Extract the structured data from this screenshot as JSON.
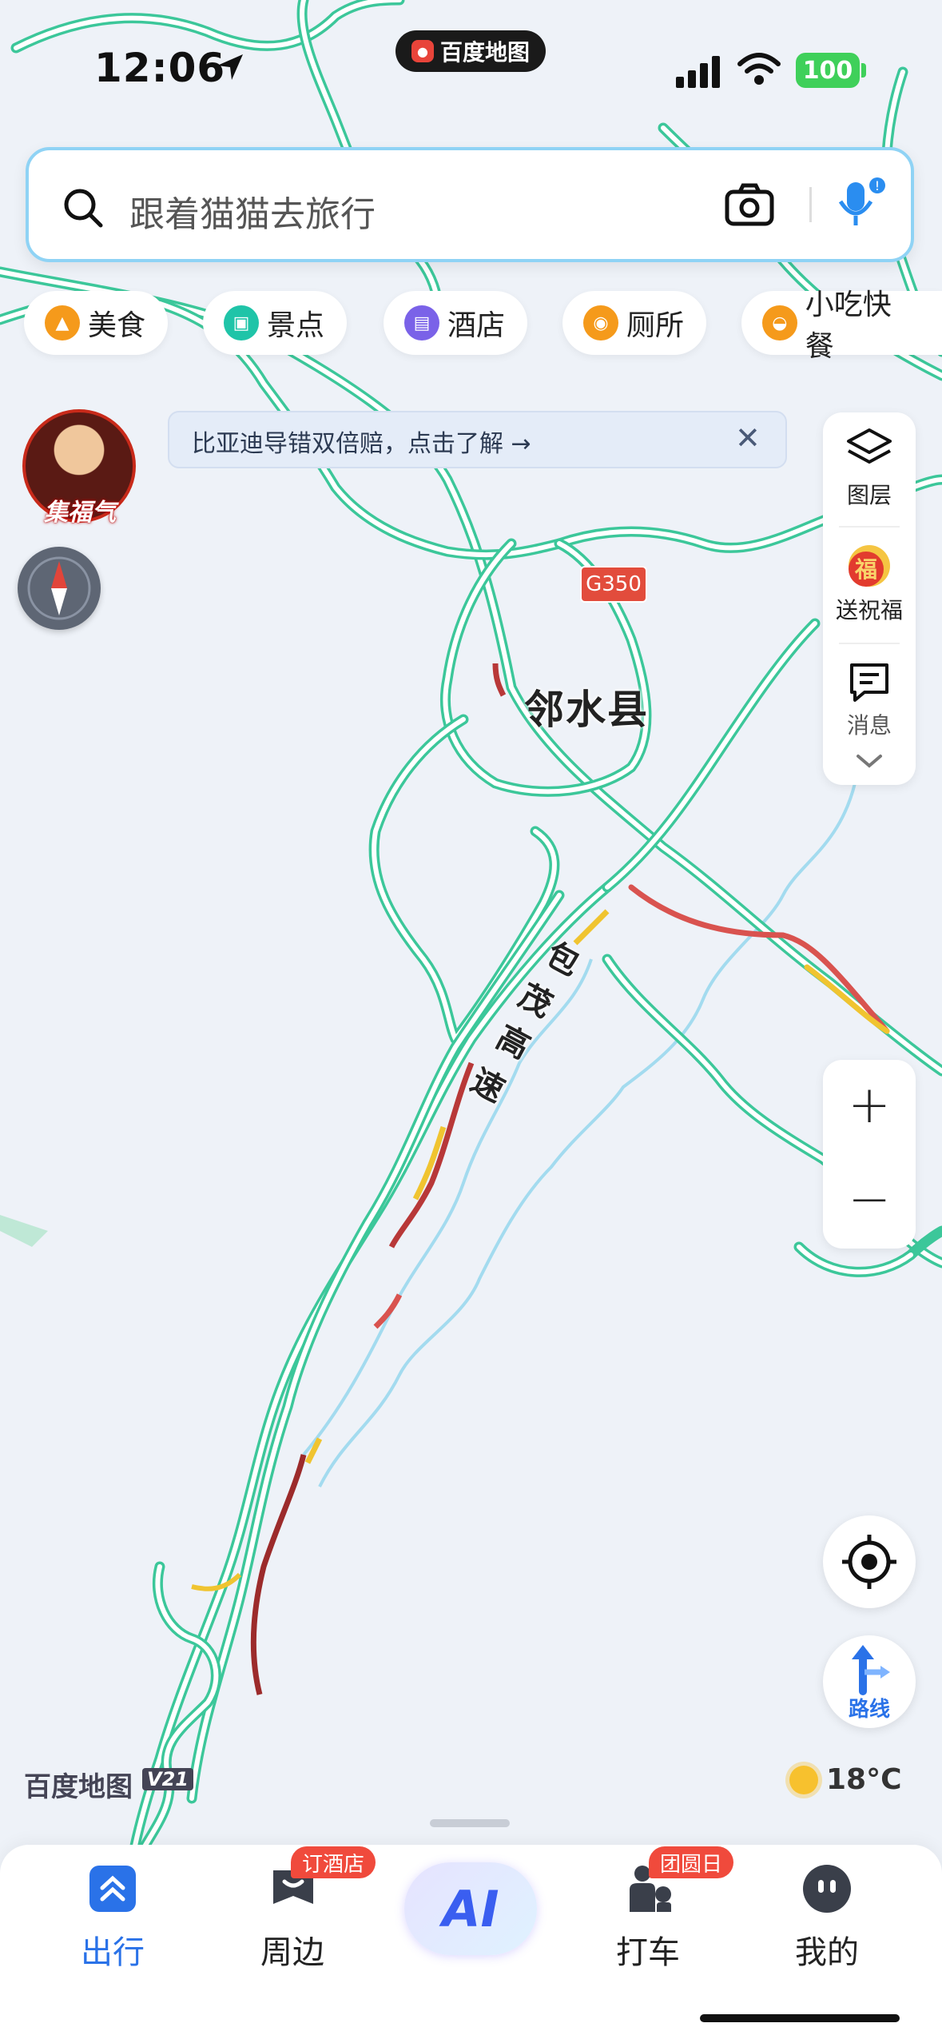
{
  "status_bar": {
    "time": "12:06",
    "app_name": "百度地图",
    "battery": "100"
  },
  "search": {
    "placeholder": "跟着猫猫去旅行"
  },
  "categories": [
    {
      "label": "美食",
      "icon": "food-icon",
      "color": "#f59a1b"
    },
    {
      "label": "景点",
      "icon": "scenery-icon",
      "color": "#1fc4a8"
    },
    {
      "label": "酒店",
      "icon": "hotel-icon",
      "color": "#7a62e8"
    },
    {
      "label": "厕所",
      "icon": "toilet-icon",
      "color": "#f59a1b"
    },
    {
      "label": "小吃快餐",
      "icon": "snack-icon",
      "color": "#f59a1b"
    }
  ],
  "avatar": {
    "label": "集福气"
  },
  "banner": {
    "text": "比亚迪导错双倍赔，点击了解 →"
  },
  "tools": {
    "layers": "图层",
    "blessing": "送祝福",
    "messages": "消息"
  },
  "zoom": {
    "in": "+",
    "out": "−"
  },
  "route": {
    "label": "路线"
  },
  "map": {
    "road_badge": "G350",
    "county": "邻水县",
    "highway_chars": [
      "包",
      "茂",
      "高",
      "速"
    ],
    "logo": "百度地图",
    "version": "V21",
    "temperature": "18°C"
  },
  "bottom_nav": {
    "items": [
      {
        "label": "出行",
        "icon": "travel-icon",
        "active": true
      },
      {
        "label": "周边",
        "icon": "nearby-icon",
        "badge": "订酒店"
      },
      {
        "label": "AI",
        "icon": "ai-icon"
      },
      {
        "label": "打车",
        "icon": "taxi-icon",
        "badge": "团圆日"
      },
      {
        "label": "我的",
        "icon": "profile-icon"
      }
    ]
  },
  "colors": {
    "road": "#3cc79a",
    "congested": "#d9534f",
    "slow": "#f0c430",
    "water": "#9ad4f0",
    "accent": "#2a72e8"
  }
}
